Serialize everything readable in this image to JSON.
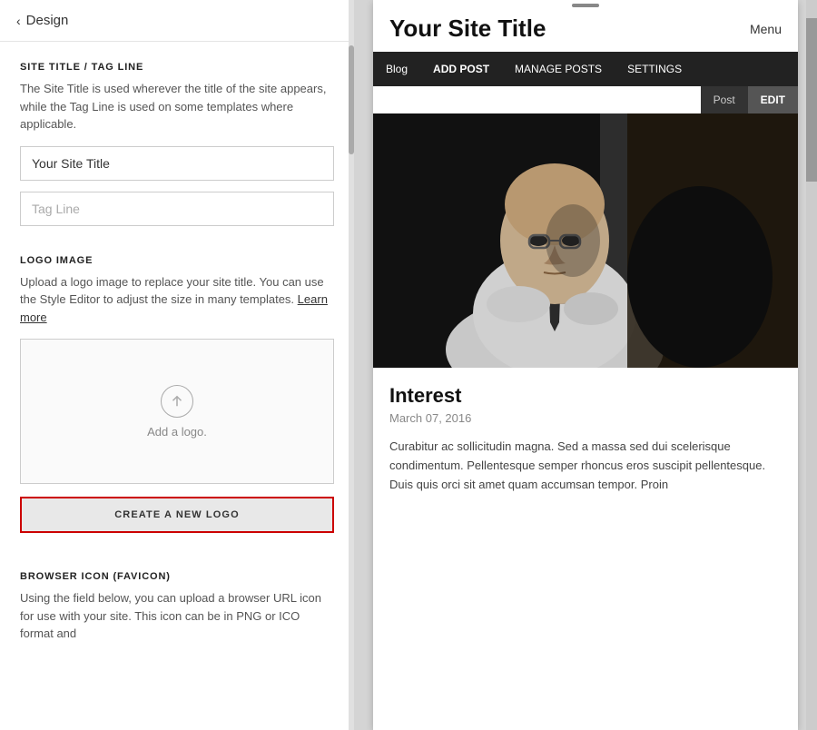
{
  "left_panel": {
    "back_button": "Design",
    "sections": {
      "site_title": {
        "heading": "SITE TITLE / TAG LINE",
        "description": "The Site Title is used wherever the title of the site appears, while the Tag Line is used on some templates where applicable.",
        "title_input_value": "Your Site Title",
        "title_input_placeholder": "Your Site Title",
        "tagline_input_value": "",
        "tagline_input_placeholder": "Tag Line"
      },
      "logo_image": {
        "heading": "LOGO IMAGE",
        "description_part1": "Upload a logo image to replace your site title. You can use the Style Editor to adjust the size in many templates.",
        "learn_more_link": "Learn more",
        "add_logo_label": "Add a logo.",
        "create_logo_button": "CREATE A NEW LOGO"
      },
      "favicon": {
        "heading": "BROWSER ICON (FAVICON)",
        "description": "Using the field below, you can upload a browser URL icon for use with your site. This icon can be in PNG or ICO format and"
      }
    }
  },
  "right_panel": {
    "site_title": "Your Site Title",
    "menu_label": "Menu",
    "nav_items": [
      {
        "label": "Blog",
        "active": false
      },
      {
        "label": "ADD POST",
        "active": true
      },
      {
        "label": "MANAGE POSTS",
        "active": false
      },
      {
        "label": "SETTINGS",
        "active": false
      }
    ],
    "dropdown_items": [
      {
        "label": "Post",
        "active": false
      },
      {
        "label": "EDIT",
        "active": true
      }
    ],
    "post": {
      "title": "Interest",
      "date": "March 07, 2016",
      "excerpt": "Curabitur ac sollicitudin magna. Sed a massa sed dui scelerisque condimentum. Pellentesque semper rhoncus eros suscipit pellentesque. Duis quis orci sit amet quam accumsan tempor. Proin"
    }
  },
  "icons": {
    "chevron_left": "‹",
    "upload_arrow": "↑"
  }
}
